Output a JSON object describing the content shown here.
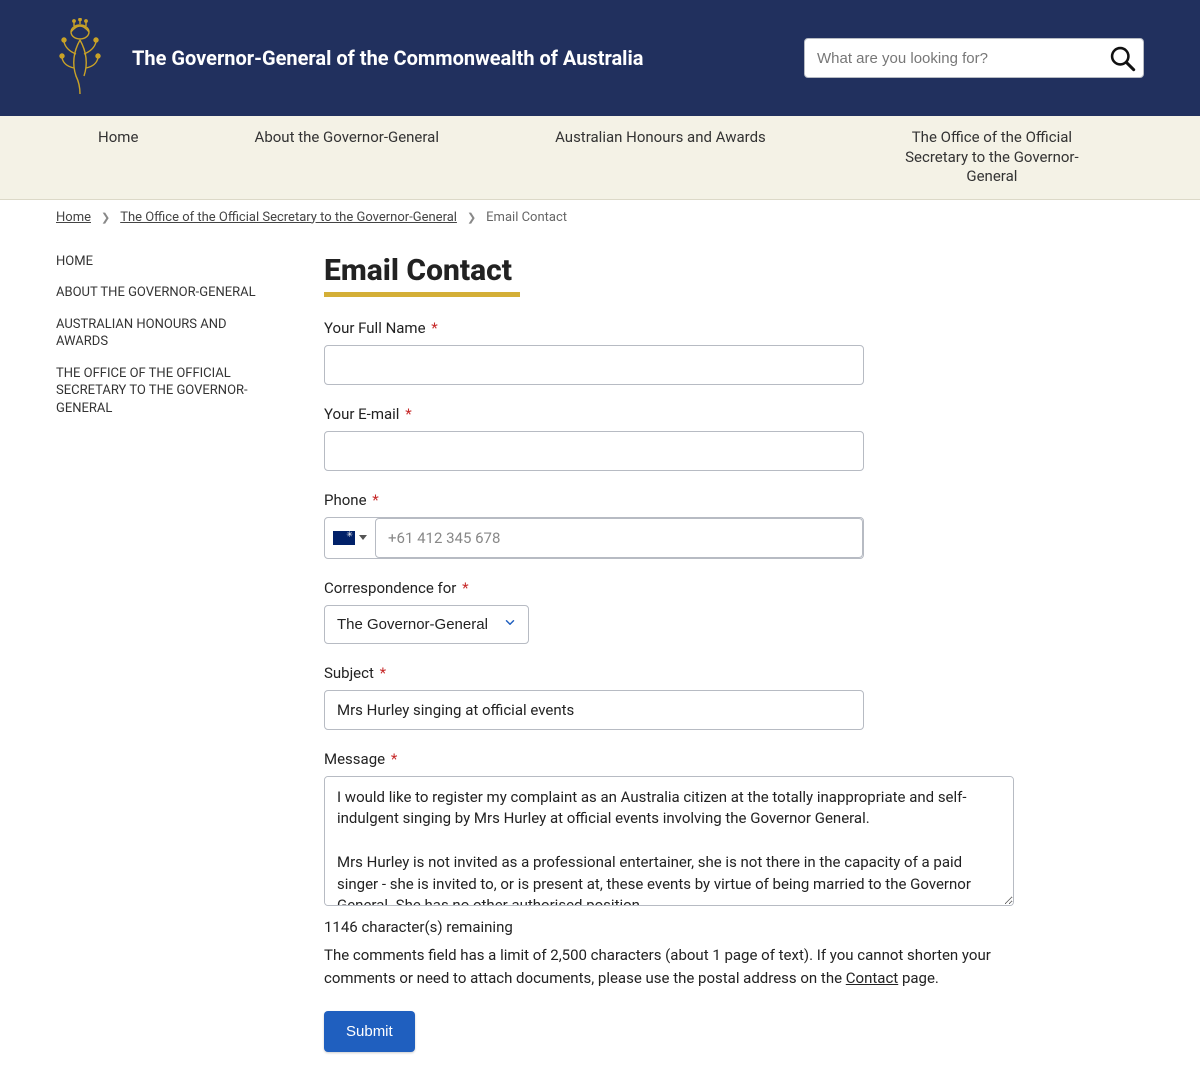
{
  "header": {
    "site_title": "The Governor-General of the Commonwealth of Australia",
    "search_placeholder": "What are you looking for?"
  },
  "nav": {
    "items": [
      "Home",
      "About the Governor-General",
      "Australian Honours and Awards",
      "The Office of the Official Secretary to the Governor-General"
    ]
  },
  "breadcrumb": {
    "home": "Home",
    "parent": "The Office of the Official Secretary to the Governor-General",
    "current": "Email Contact"
  },
  "sidebar": {
    "items": [
      "HOME",
      "ABOUT THE GOVERNOR-GENERAL",
      "AUSTRALIAN HONOURS AND AWARDS",
      "THE OFFICE OF THE OFFICIAL SECRETARY TO THE GOVERNOR-GENERAL"
    ]
  },
  "page": {
    "title": "Email Contact"
  },
  "form": {
    "full_name": {
      "label": "Your Full Name",
      "value": ""
    },
    "email": {
      "label": "Your E-mail",
      "value": ""
    },
    "phone": {
      "label": "Phone",
      "placeholder": "+61 412 345 678",
      "value": ""
    },
    "correspondence": {
      "label": "Correspondence for",
      "selected": "The Governor-General"
    },
    "subject": {
      "label": "Subject",
      "value": "Mrs Hurley singing at official events"
    },
    "message": {
      "label": "Message",
      "value": "I would like to register my complaint as an Australia citizen at the totally inappropriate and self-indulgent singing by Mrs Hurley at official events involving the Governor General.\n\nMrs Hurley is not invited as a professional entertainer, she is not there in the capacity of a paid singer - she is invited to, or is present at, these events by virtue of being married to the Governor General. She has no other authorised position."
    },
    "remaining": "1146 character(s) remaining",
    "limit_text_pre": "The comments field has a limit of 2,500 characters (about 1 page of text). If you cannot shorten your comments or need to attach documents, please use the postal address on the ",
    "limit_link": "Contact",
    "limit_text_post": " page.",
    "submit": "Submit"
  }
}
